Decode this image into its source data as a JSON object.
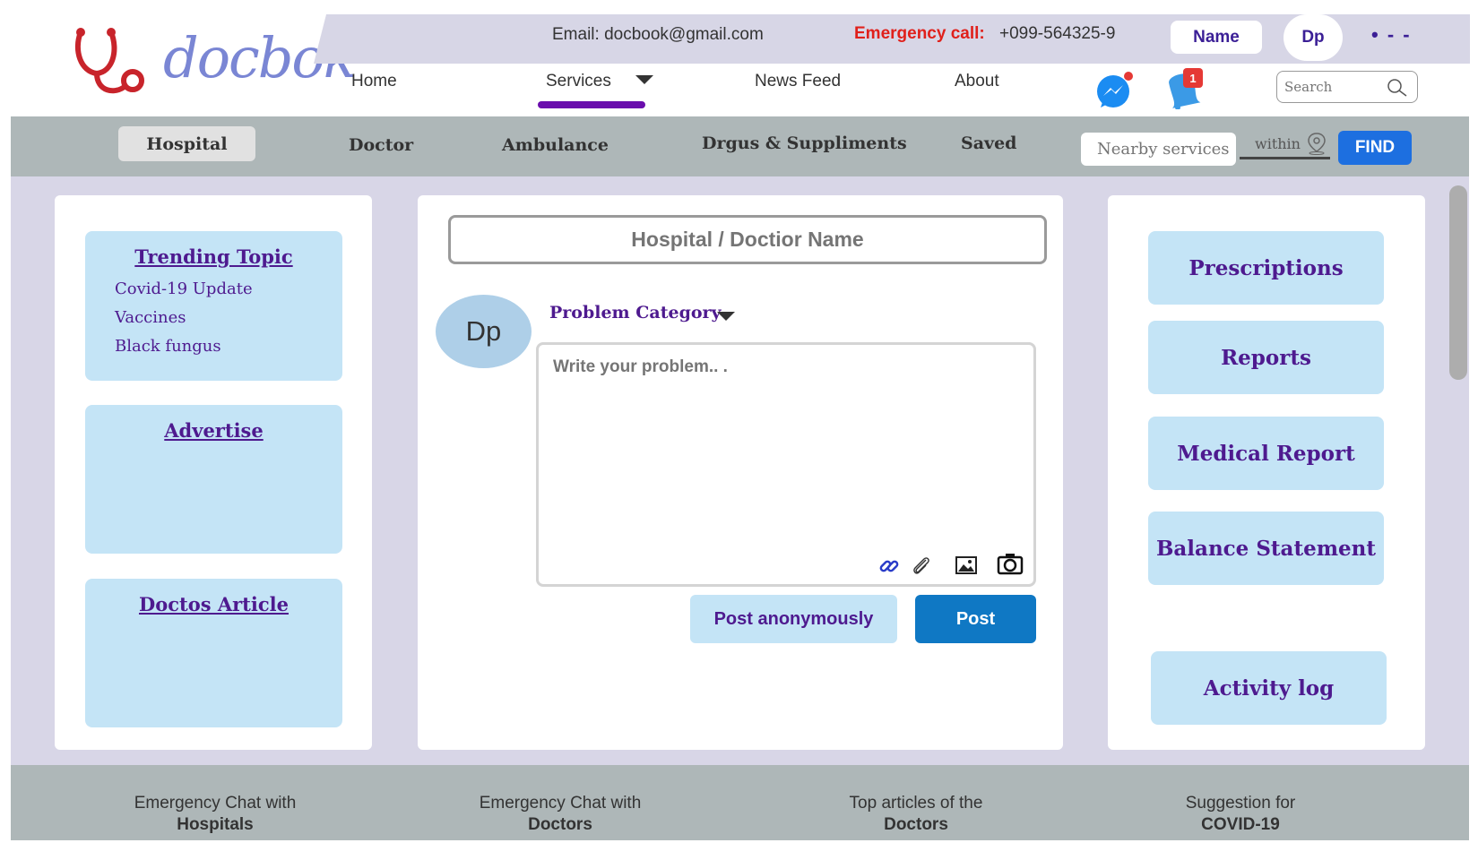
{
  "brand": {
    "logo_text": "docbok"
  },
  "header": {
    "email": "Email: docbook@gmail.com",
    "emergency_label": "Emergency call:",
    "emergency_number": "+099-564325-9",
    "name_button": "Name",
    "avatar_initials": "Dp",
    "more": "• - -"
  },
  "nav": {
    "items": [
      "Home",
      "Services",
      "News Feed",
      "About"
    ],
    "active": "Services",
    "messenger_badge": "",
    "notification_badge": "1",
    "search_placeholder": "Search"
  },
  "categories": {
    "items": [
      "Hospital",
      "Doctor",
      "Ambulance",
      "Drgus & Suppliments",
      "Saved"
    ],
    "active": "Hospital",
    "nearby_placeholder": "Nearby services",
    "within_label": "within",
    "find_label": "FIND"
  },
  "left_panel": {
    "trending": {
      "title": "Trending Topic",
      "topics": [
        "Covid-19 Update",
        "Vaccines",
        "Black fungus"
      ]
    },
    "advertise_title": "Advertise",
    "article_title": "Doctos Article"
  },
  "composer": {
    "name_placeholder": "Hospital / Doctior Name",
    "avatar_initials": "Dp",
    "problem_category_label": "Problem Category",
    "problem_placeholder": "Write your problem.. .",
    "post_anonymously_label": "Post anonymously",
    "post_label": "Post"
  },
  "right_panel": {
    "items": [
      "Prescriptions",
      "Reports",
      "Medical Report",
      "Balance Statement",
      "Activity log"
    ]
  },
  "footer": {
    "items": [
      {
        "line1": "Emergency Chat with",
        "line2": "Hospitals"
      },
      {
        "line1": "Emergency Chat with",
        "line2": "Doctors"
      },
      {
        "line1": "Top articles of the",
        "line2": "Doctors"
      },
      {
        "line1": "Suggestion for",
        "line2": "COVID-19"
      }
    ]
  },
  "colors": {
    "brand_purple": "#4e1a8f",
    "emergency_red": "#e0201b",
    "find_blue": "#1d6fe0",
    "post_blue": "#0f78c4",
    "card_blue": "#c4e4f6"
  }
}
